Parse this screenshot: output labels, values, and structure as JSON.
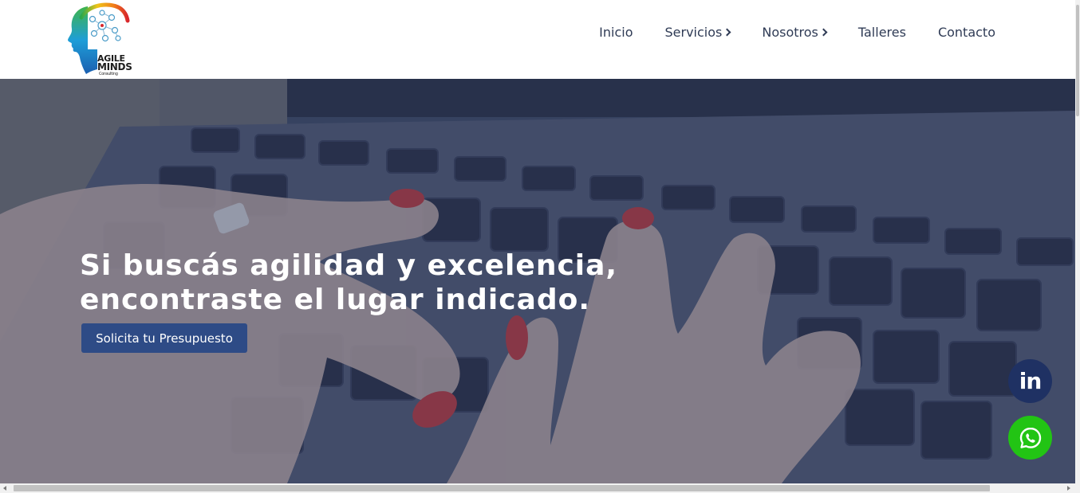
{
  "brand": {
    "name_line1": "AGILE",
    "name_line2": "MINDS",
    "name_line3": "Consulting",
    "logo_icon": "head-network-logo"
  },
  "nav": {
    "items": [
      {
        "label": "Inicio",
        "has_submenu": false
      },
      {
        "label": "Servicios",
        "has_submenu": true
      },
      {
        "label": "Nosotros",
        "has_submenu": true
      },
      {
        "label": "Talleres",
        "has_submenu": false
      },
      {
        "label": "Contacto",
        "has_submenu": false
      }
    ]
  },
  "hero": {
    "title_line1": "Si buscás agilidad y excelencia,",
    "title_line2": "encontraste el lugar indicado.",
    "cta_label": "Solicita tu Presupuesto",
    "background": "hands-typing-on-laptop-keyboard"
  },
  "floating": {
    "linkedin_label": "in",
    "linkedin_icon": "linkedin-icon",
    "whatsapp_icon": "whatsapp-icon"
  },
  "colors": {
    "nav_text": "#2f3b55",
    "cta_bg": "#2e4b86",
    "linkedin_bg": "#1f3163",
    "whatsapp_bg": "#22c414"
  }
}
